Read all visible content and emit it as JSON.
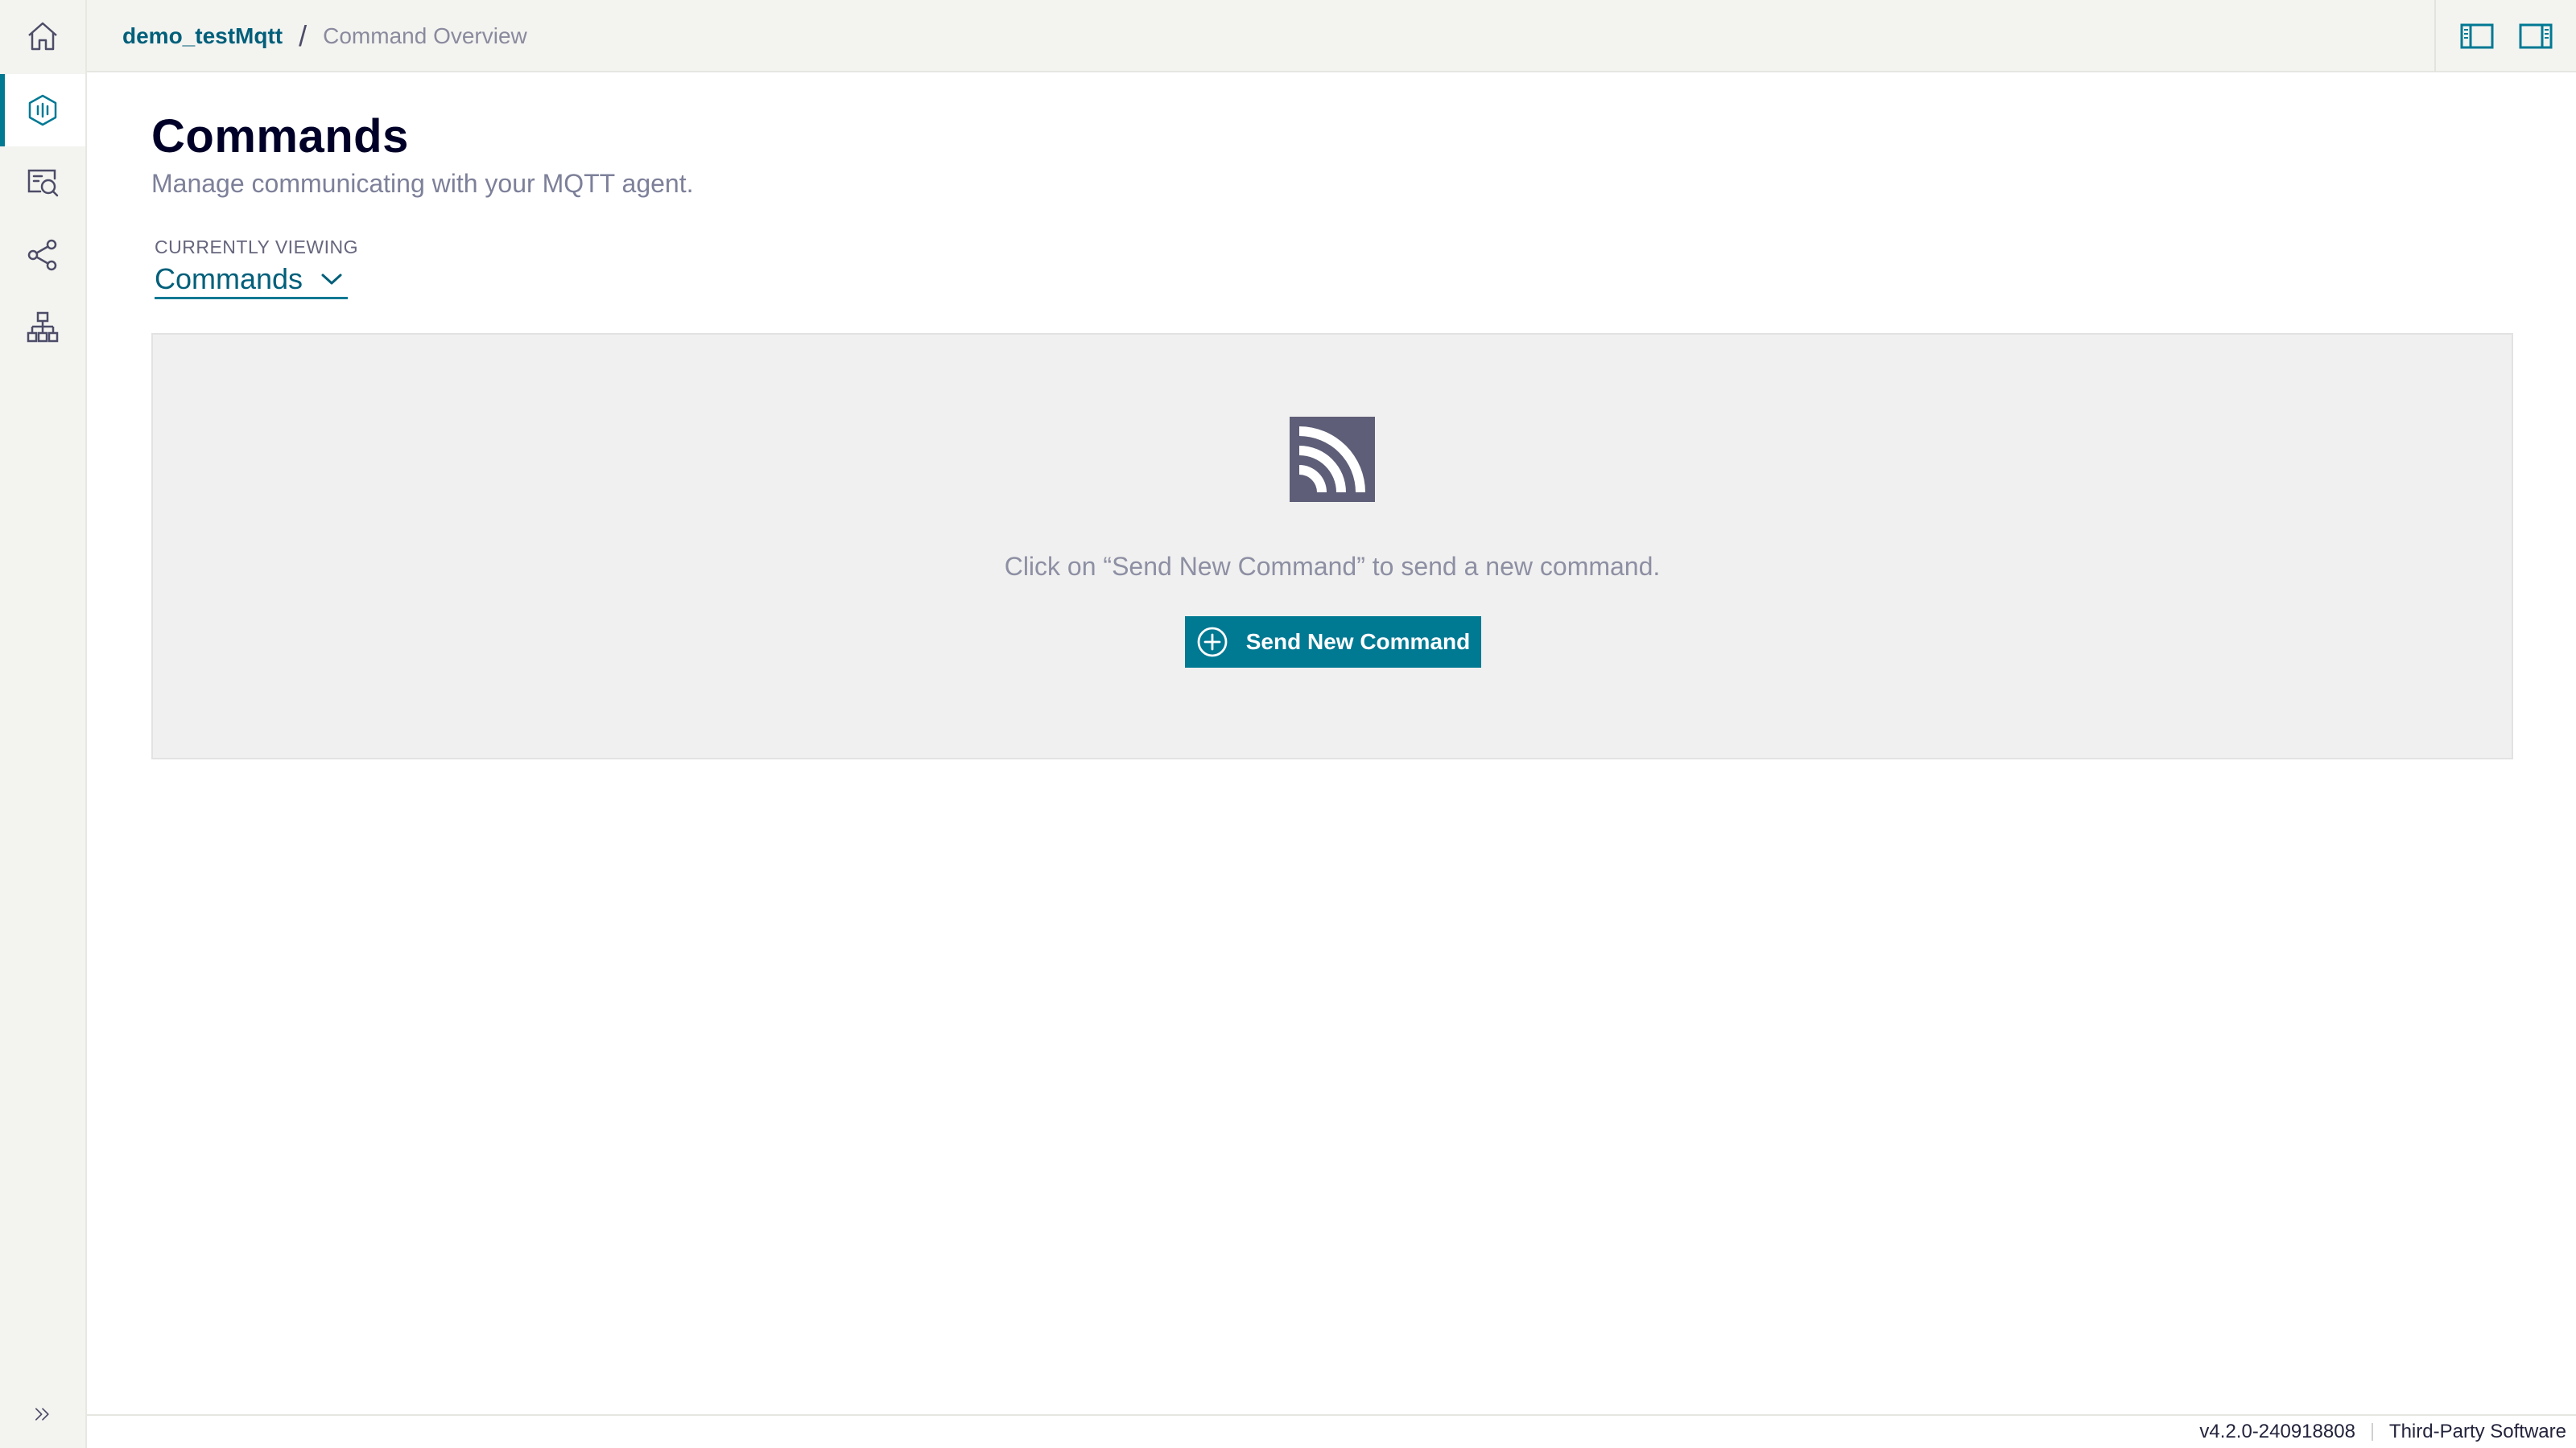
{
  "colors": {
    "accent": "#007993",
    "accent_dark": "#005f7a",
    "title": "#000028",
    "muted": "#7d8099",
    "rail_bg": "#f3f3f0",
    "panel_bg": "#f0f0f0",
    "icon_dark": "#5e5e78"
  },
  "rail": {
    "items": [
      {
        "icon": "home-icon",
        "active": false
      },
      {
        "icon": "monitor-hex-icon",
        "active": true
      },
      {
        "icon": "inspect-icon",
        "active": false
      },
      {
        "icon": "share-icon",
        "active": false
      },
      {
        "icon": "hierarchy-icon",
        "active": false
      }
    ],
    "expand_icon": "double-chevron-right-icon"
  },
  "header": {
    "breadcrumb_root": "demo_testMqtt",
    "breadcrumb_separator": "/",
    "breadcrumb_current": "Command Overview",
    "actions": [
      {
        "icon": "left-panel-icon"
      },
      {
        "icon": "right-panel-icon"
      }
    ]
  },
  "main": {
    "title": "Commands",
    "subtitle": "Manage communicating with your MQTT agent.",
    "viewing_label": "CURRENTLY VIEWING",
    "viewing_value": "Commands",
    "empty_state": {
      "icon": "broadcast-icon",
      "message": "Click on “Send New Command” to send a new command.",
      "button_label": "Send New Command",
      "button_icon": "plus-circle-icon"
    }
  },
  "footer": {
    "version": "v4.2.0-240918808",
    "third_party": "Third-Party Software"
  }
}
